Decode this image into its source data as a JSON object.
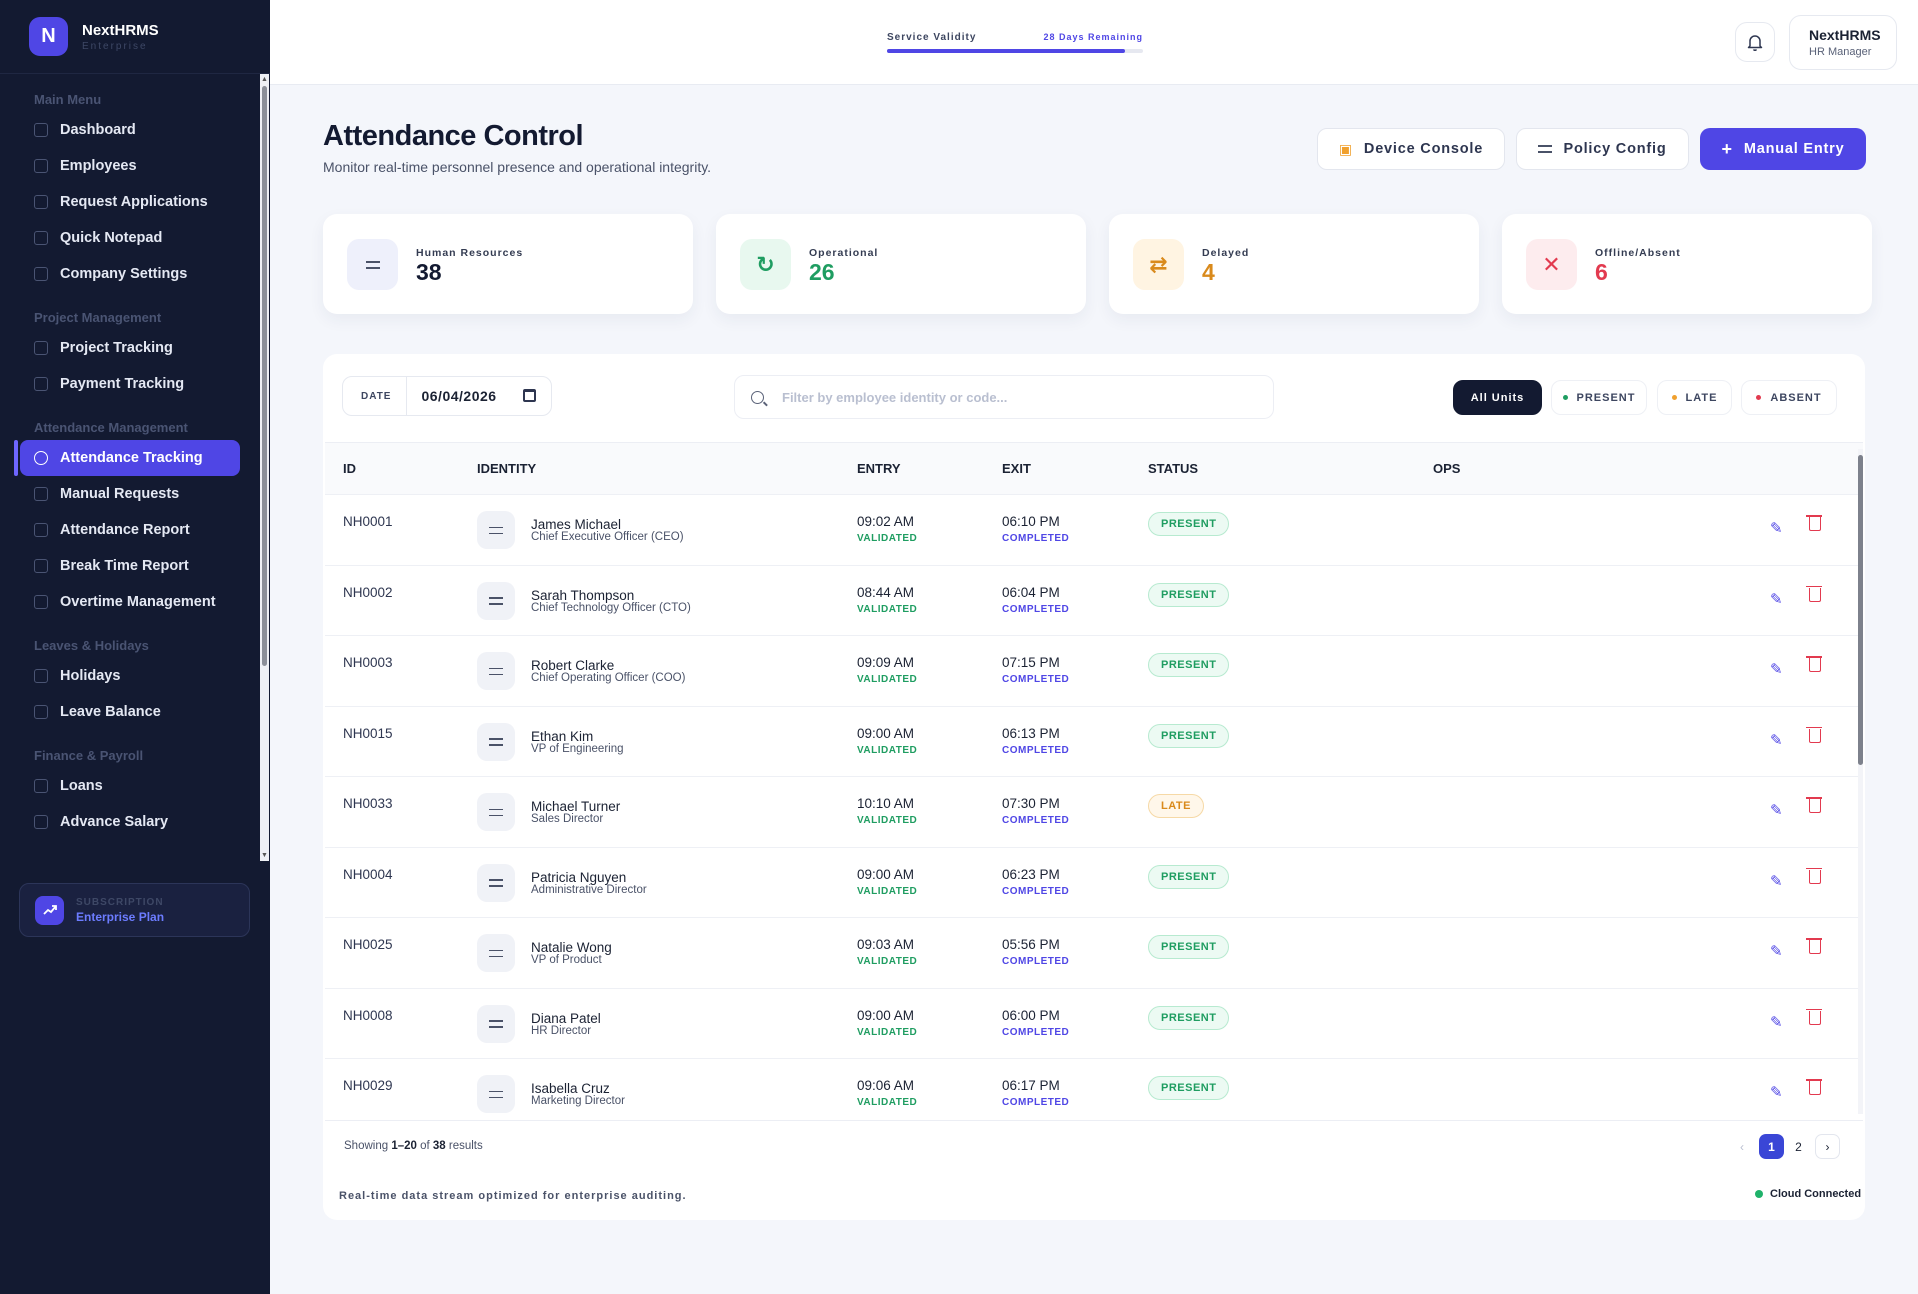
{
  "brand": {
    "logo_letter": "N",
    "name": "NextHRMS",
    "subtitle": "Enterprise"
  },
  "sidebar": {
    "sections": [
      {
        "title": "Main Menu",
        "items": [
          "Dashboard",
          "Employees",
          "Request Applications",
          "Quick Notepad",
          "Company Settings"
        ]
      },
      {
        "title": "Project Management",
        "items": [
          "Project Tracking",
          "Payment Tracking"
        ]
      },
      {
        "title": "Attendance Management",
        "items": [
          "Attendance Tracking",
          "Manual Requests",
          "Attendance Report",
          "Break Time Report",
          "Overtime Management"
        ]
      },
      {
        "title": "Leaves & Holidays",
        "items": [
          "Holidays",
          "Leave Balance"
        ]
      },
      {
        "title": "Finance & Payroll",
        "items": [
          "Loans",
          "Advance Salary"
        ]
      }
    ],
    "active_item": "Attendance Tracking",
    "subscription": {
      "label": "SUBSCRIPTION",
      "plan": "Enterprise Plan"
    }
  },
  "topbar": {
    "validity_label": "Service Validity",
    "validity_remaining": "28 Days Remaining",
    "validity_progress": 0.93,
    "user_name": "NextHRMS",
    "user_role": "HR Manager"
  },
  "header": {
    "title": "Attendance Control",
    "subtitle": "Monitor real-time personnel presence and operational integrity.",
    "device_console_label": "Device Console",
    "policy_config_label": "Policy Config",
    "manual_entry_label": "Manual Entry"
  },
  "stats": [
    {
      "label": "Human Resources",
      "value": "38",
      "color": "#131a31",
      "icon_bg": "#eef0fb",
      "icon_color": "#4f46e5",
      "icon": "sliders-icon"
    },
    {
      "label": "Operational",
      "value": "26",
      "color": "#1f9d61",
      "icon_bg": "#e8f8ef",
      "icon_color": "#1f9d61",
      "icon": "refresh-icon"
    },
    {
      "label": "Delayed",
      "value": "4",
      "color": "#d98a1c",
      "icon_bg": "#fff4e2",
      "icon_color": "#d98a1c",
      "icon": "sync-icon"
    },
    {
      "label": "Offline/Absent",
      "value": "6",
      "color": "#e23a4f",
      "icon_bg": "#fdecee",
      "icon_color": "#e23a4f",
      "icon": "close-icon"
    }
  ],
  "filters": {
    "date_label": "DATE",
    "date_value": "06/04/2026",
    "search_placeholder": "Filter by employee identity or code...",
    "all_label": "All Units",
    "present_label": "PRESENT",
    "late_label": "LATE",
    "absent_label": "ABSENT",
    "present_color": "#1f9d61",
    "late_color": "#f0a02e",
    "absent_color": "#e23a4f"
  },
  "table": {
    "columns": [
      "ID",
      "IDENTITY",
      "ENTRY",
      "EXIT",
      "STATUS",
      "OPS"
    ],
    "entry_status": "VALIDATED",
    "exit_status": "COMPLETED",
    "rows": [
      {
        "id": "NH0001",
        "name": "James Michael",
        "role": "Chief Executive Officer (CEO)",
        "entry": "09:02 AM",
        "exit": "06:10 PM",
        "status": "PRESENT"
      },
      {
        "id": "NH0002",
        "name": "Sarah Thompson",
        "role": "Chief Technology Officer (CTO)",
        "entry": "08:44 AM",
        "exit": "06:04 PM",
        "status": "PRESENT"
      },
      {
        "id": "NH0003",
        "name": "Robert Clarke",
        "role": "Chief Operating Officer (COO)",
        "entry": "09:09 AM",
        "exit": "07:15 PM",
        "status": "PRESENT"
      },
      {
        "id": "NH0015",
        "name": "Ethan Kim",
        "role": "VP of Engineering",
        "entry": "09:00 AM",
        "exit": "06:13 PM",
        "status": "PRESENT"
      },
      {
        "id": "NH0033",
        "name": "Michael Turner",
        "role": "Sales Director",
        "entry": "10:10 AM",
        "exit": "07:30 PM",
        "status": "LATE"
      },
      {
        "id": "NH0004",
        "name": "Patricia Nguyen",
        "role": "Administrative Director",
        "entry": "09:00 AM",
        "exit": "06:23 PM",
        "status": "PRESENT"
      },
      {
        "id": "NH0025",
        "name": "Natalie Wong",
        "role": "VP of Product",
        "entry": "09:03 AM",
        "exit": "05:56 PM",
        "status": "PRESENT"
      },
      {
        "id": "NH0008",
        "name": "Diana Patel",
        "role": "HR Director",
        "entry": "09:00 AM",
        "exit": "06:00 PM",
        "status": "PRESENT"
      },
      {
        "id": "NH0029",
        "name": "Isabella Cruz",
        "role": "Marketing Director",
        "entry": "09:06 AM",
        "exit": "06:17 PM",
        "status": "PRESENT"
      }
    ]
  },
  "pagination": {
    "showing_prefix": "Showing ",
    "showing_range": "1–20",
    "showing_of": " of ",
    "showing_total": "38",
    "showing_suffix": " results",
    "pages": [
      "1",
      "2"
    ],
    "current_page": "1"
  },
  "footer": {
    "note": "Real-time data stream optimized for enterprise auditing.",
    "connection": "Cloud Connected"
  }
}
